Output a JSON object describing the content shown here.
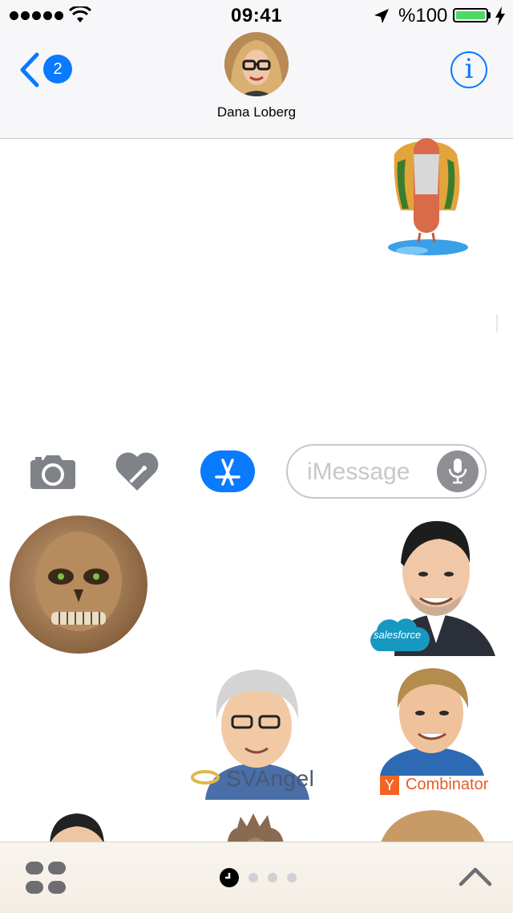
{
  "status_bar": {
    "time": "09:41",
    "battery_percent": "%100",
    "signal_bars": 5,
    "battery_level": 1.0
  },
  "header": {
    "back_badge_count": "2",
    "contact_name": "Dana Loberg",
    "info_label": "i"
  },
  "compose": {
    "placeholder": "iMessage"
  },
  "stickers": {
    "svangel_label": "SVAngel",
    "yc_letter": "Y",
    "yc_label": "Combinator",
    "salesforce_label": "salesforce"
  },
  "pager": {
    "page_count": 4,
    "current_page": 1
  },
  "colors": {
    "accent": "#0a7aff",
    "battery_fill": "#4cd964",
    "placeholder_gray": "#c7c7cc"
  },
  "icons": {
    "back": "chevron-left-icon",
    "info": "info-icon",
    "camera": "camera-icon",
    "digital_touch": "heart-icon",
    "apps": "app-store-icon",
    "mic": "microphone-icon",
    "app_drawer": "grid-icon",
    "expand": "chevron-up-icon"
  }
}
